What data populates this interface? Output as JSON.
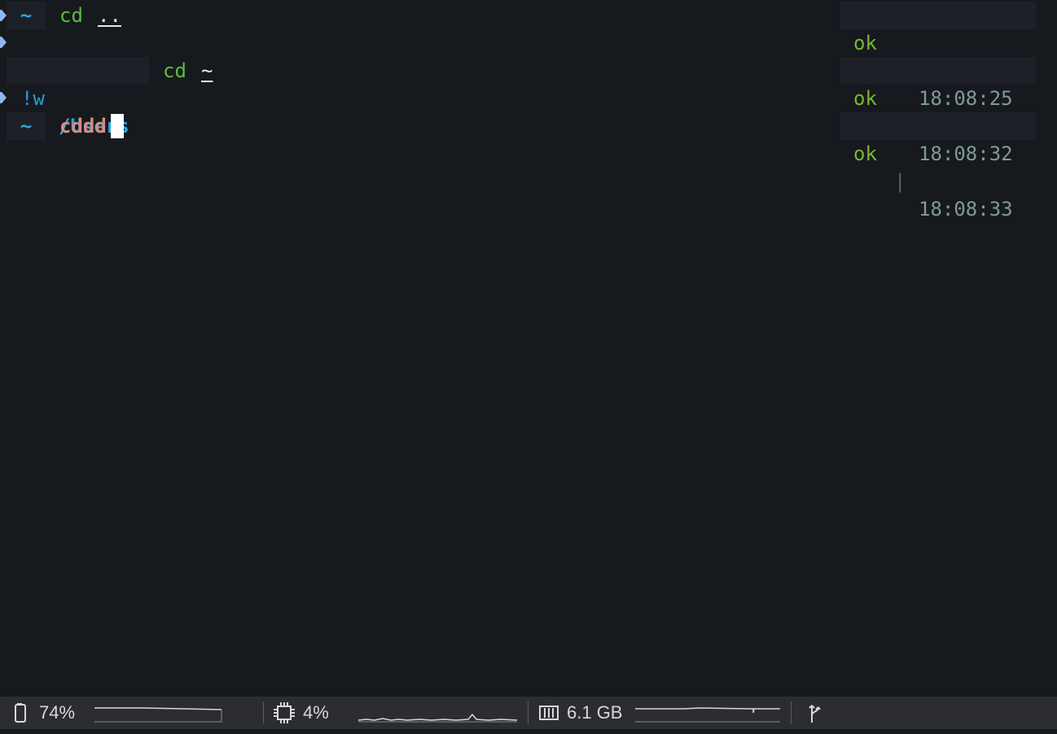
{
  "terminal": {
    "lines": [
      {
        "prompt": "~",
        "command": "cd",
        "argument": "..",
        "status": "ok",
        "separator": "|",
        "time": "18:08:25"
      },
      {
        "prompt_prefix": "!w",
        "prompt_path": "/Users",
        "command": "cd",
        "argument": "~",
        "status": "ok",
        "separator": "|",
        "time": "18:08:32"
      },
      {
        "prompt": "~",
        "command": "cddd",
        "status": "ok",
        "separator": "|",
        "time": "18:08:33"
      }
    ]
  },
  "statusbar": {
    "battery": {
      "icon": "battery-icon",
      "value": "74%"
    },
    "cpu": {
      "icon": "cpu-icon",
      "value": "4%"
    },
    "memory": {
      "icon": "memory-icon",
      "value": "6.1 GB"
    },
    "git": {
      "icon": "git-branch-icon"
    }
  },
  "colors": {
    "background": "#16191e",
    "accent_blue": "#2aa8e0",
    "command_green": "#5cbf3a",
    "command_error": "#d98a7e",
    "status_ok": "#79b82d",
    "time": "#7f9a98"
  }
}
